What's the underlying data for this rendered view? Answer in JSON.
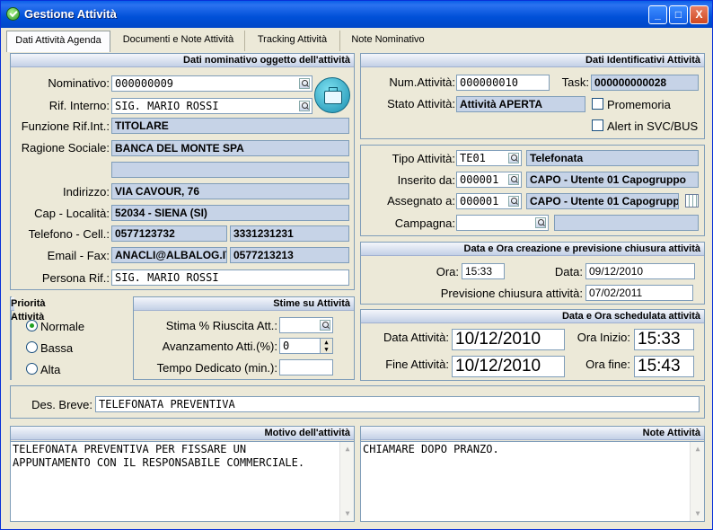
{
  "window": {
    "title": "Gestione Attività",
    "minimize": "_",
    "maximize": "□",
    "close": "X"
  },
  "tabs": [
    "Dati Attività Agenda",
    "Documenti e Note Attività",
    "Tracking Attività",
    "Note Nominativo"
  ],
  "nominativo_panel": {
    "header": "Dati nominativo oggetto dell'attività",
    "nominativo_label": "Nominativo:",
    "nominativo": "000000009",
    "rif_interno_label": "Rif. Interno:",
    "rif_interno": "SIG. MARIO ROSSI",
    "funzione_label": "Funzione Rif.Int.:",
    "funzione": "TITOLARE",
    "ragione_label": "Ragione Sociale:",
    "ragione": "BANCA DEL MONTE SPA",
    "ragione2": "",
    "indirizzo_label": "Indirizzo:",
    "indirizzo": "VIA CAVOUR, 76",
    "cap_label": "Cap - Località:",
    "cap": "52034 - SIENA (SI)",
    "telefono_label": "Telefono - Cell.:",
    "telefono": "0577123732",
    "cell": "3331231231",
    "email_label": "Email - Fax:",
    "email": "ANACLI@ALBALOG.IT",
    "fax": "0577213213",
    "persona_label": "Persona Rif.:",
    "persona": "SIG. MARIO ROSSI"
  },
  "identificativi_panel": {
    "header": "Dati Identificativi Attività",
    "num_label": "Num.Attività:",
    "num": "000000010",
    "task_label": "Task:",
    "task": "000000000028",
    "stato_label": "Stato Attività:",
    "stato": "Attività APERTA",
    "promemoria_label": "Promemoria",
    "alert_label": "Alert in SVC/BUS"
  },
  "tipo_panel": {
    "tipo_label": "Tipo Attività:",
    "tipo_code": "TE01",
    "tipo_desc": "Telefonata",
    "inserito_label": "Inserito da:",
    "inserito_code": "000001",
    "inserito_desc": "CAPO - Utente 01 Capogruppo",
    "assegnato_label": "Assegnato a:",
    "assegnato_code": "000001",
    "assegnato_desc": "CAPO - Utente 01 Capogruppo",
    "campagna_label": "Campagna:",
    "campagna_code": "",
    "campagna_desc": ""
  },
  "creazione_panel": {
    "header": "Data e Ora creazione e previsione chiusura attività",
    "ora_label": "Ora:",
    "ora": "15:33",
    "data_label": "Data:",
    "data": "09/12/2010",
    "previsione_label": "Previsione chiusura attività:",
    "previsione": "07/02/2011"
  },
  "schedulata_panel": {
    "header": "Data e Ora schedulata attività",
    "data_att_label": "Data Attività:",
    "data_att": "10/12/2010",
    "ora_inizio_label": "Ora Inizio:",
    "ora_inizio": "15:33",
    "fine_att_label": "Fine Attività:",
    "fine_att": "10/12/2010",
    "ora_fine_label": "Ora fine:",
    "ora_fine": "15:43"
  },
  "priorita_panel": {
    "header": "Priorità Attività",
    "options": [
      "Normale",
      "Bassa",
      "Alta"
    ],
    "selected": "Normale"
  },
  "stime_panel": {
    "header": "Stime su Attività",
    "riuscita_label": "Stima % Riuscita Att.:",
    "riuscita": "",
    "avanzamento_label": "Avanzamento Atti.(%):",
    "avanzamento": "0",
    "tempo_label": "Tempo Dedicato (min.):",
    "tempo": ""
  },
  "des_breve": {
    "label": "Des. Breve:",
    "value": "TELEFONATA PREVENTIVA"
  },
  "motivo": {
    "header": "Motivo dell'attività",
    "text": "TELEFONATA PREVENTIVA PER FISSARE UN\nAPPUNTAMENTO CON IL RESPONSABILE COMMERCIALE."
  },
  "note": {
    "header": "Note Attività",
    "text": "CHIAMARE DOPO PRANZO."
  },
  "colors": {
    "title_bar": "#0050d8",
    "panel_header": "#c3d0e6",
    "readonly_field": "#c6d3e7",
    "window_bg": "#ece9d8"
  }
}
